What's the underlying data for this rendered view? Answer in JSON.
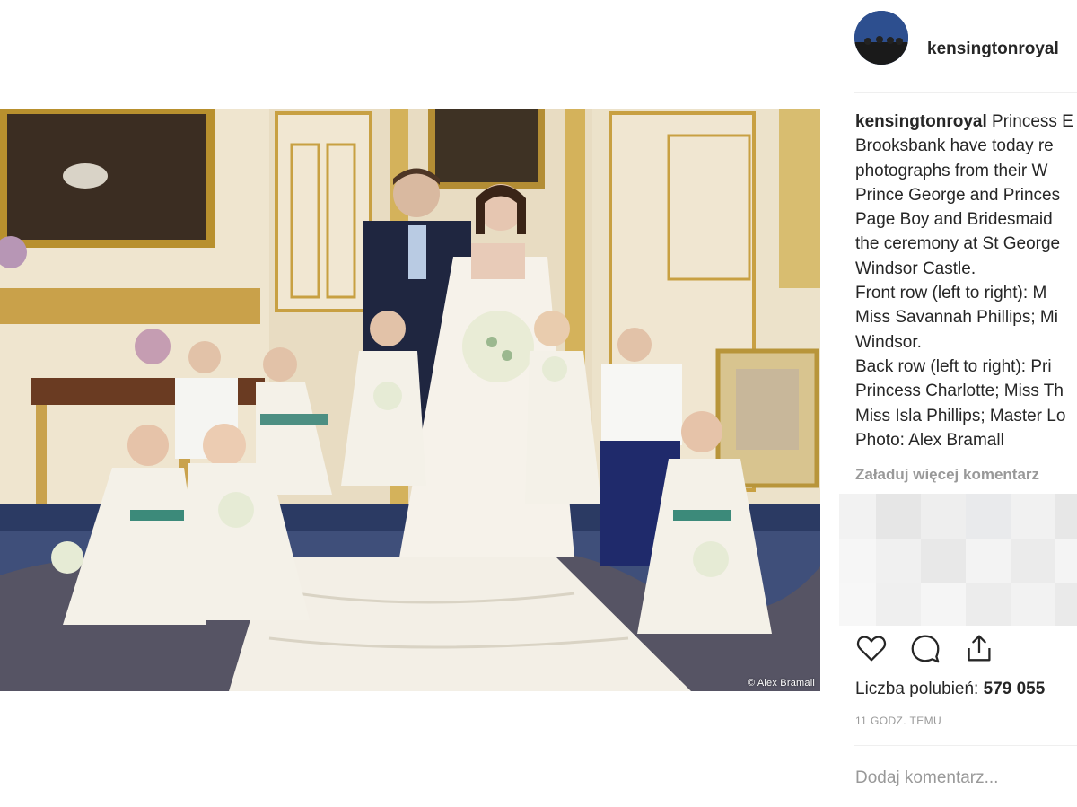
{
  "post": {
    "image_alt": "Wedding portrait with bridesmaids and page boys",
    "credit": "© Alex Bramall"
  },
  "profile": {
    "username": "kensingtonroyal",
    "avatar_icon": "profile-avatar"
  },
  "caption": {
    "username": "kensingtonroyal",
    "first_line_rest": " Princess E",
    "lines": [
      "Brooksbank have today re",
      "photographs from their W",
      "Prince George and Princes",
      "Page Boy and Bridesmaid",
      "the ceremony at St George",
      "Windsor Castle.",
      "Front row (left to right): M",
      "Miss Savannah Phillips; Mi",
      "Windsor.",
      "Back row (left to right): Pri",
      "Princess Charlotte; Miss Th",
      "Miss Isla Phillips; Master Lo",
      "Photo: Alex Bramall"
    ]
  },
  "comments": {
    "load_more": "Załaduj więcej komentarz"
  },
  "actions": {
    "like_icon": "heart-icon",
    "comment_icon": "comment-icon",
    "share_icon": "share-icon"
  },
  "likes": {
    "label": "Liczba polubień:",
    "count": "579 055"
  },
  "timestamp": "11 godz. temu",
  "add_comment": {
    "placeholder": "Dodaj komentarz..."
  },
  "colors": {
    "text": "#262626",
    "muted": "#999999",
    "verified": "#3897f0"
  }
}
